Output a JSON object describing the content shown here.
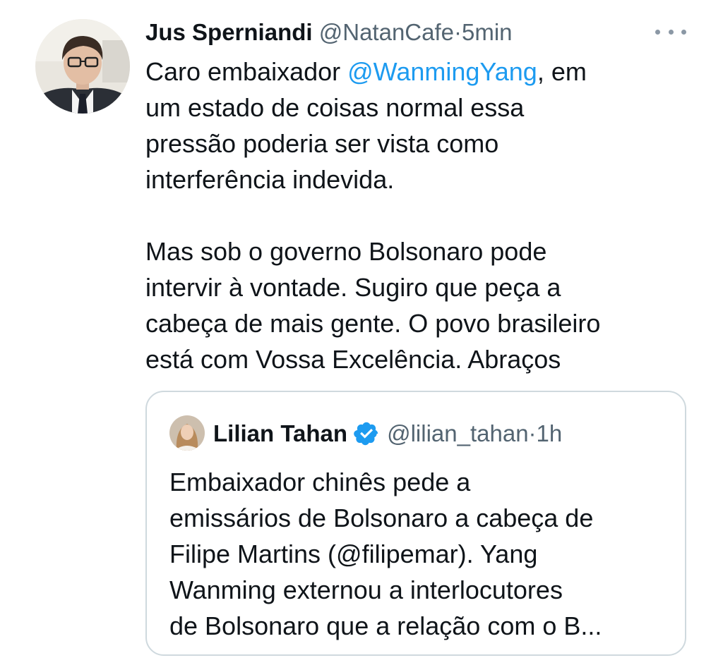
{
  "tweet": {
    "author_name": "Jus Sperniandi",
    "author_handle": "@NatanCafe",
    "separator": "·",
    "timestamp": "5min",
    "text_lines": [
      {
        "before": "Caro embaixador ",
        "mention": "@WanmingYang",
        "after": ", em"
      },
      {
        "text": "um estado de coisas normal essa"
      },
      {
        "text": "pressão poderia ser vista como"
      },
      {
        "text": "interferência indevida."
      },
      {
        "text": "Mas sob o governo Bolsonaro pode"
      },
      {
        "text": "intervir à vontade. Sugiro que peça a"
      },
      {
        "text": "cabeça de mais gente. O povo brasileiro"
      },
      {
        "text": "está com Vossa Excelência. Abraços"
      }
    ]
  },
  "quote": {
    "author_name": "Lilian Tahan",
    "author_handle": "@lilian_tahan",
    "separator": "·",
    "timestamp": "1h",
    "text_lines": [
      "Embaixador chinês pede a",
      "emissários de Bolsonaro a cabeça de",
      "Filipe Martins (@filipemar). Yang",
      "Wanming externou a interlocutores",
      "de Bolsonaro que a relação com o B..."
    ]
  },
  "icons": {
    "more": "more-options-icon",
    "verified": "verified-badge-icon"
  },
  "colors": {
    "text": "#0f1419",
    "secondary": "#536471",
    "link": "#1d9bf0",
    "border": "#cfd9de",
    "verified": "#1d9bf0"
  }
}
